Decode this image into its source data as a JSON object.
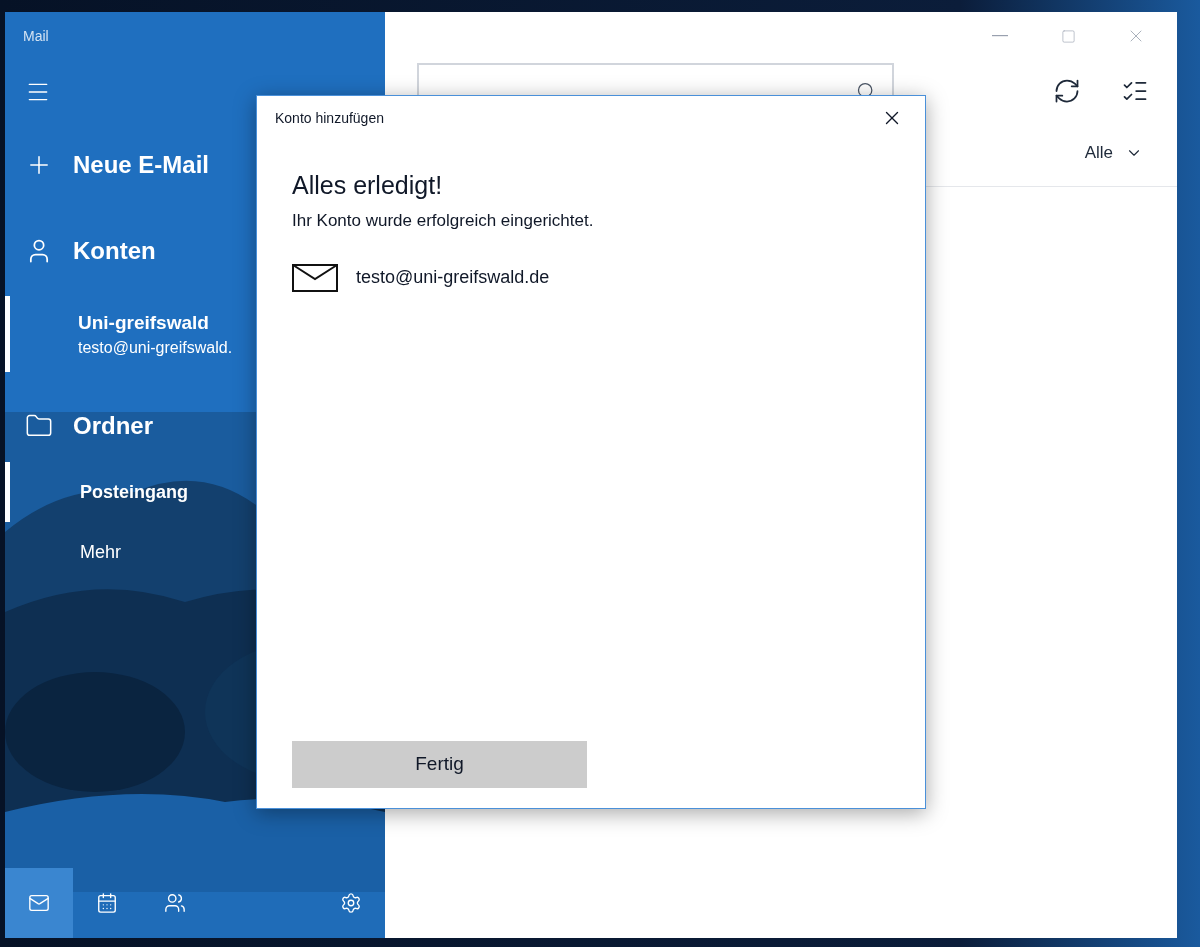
{
  "window": {
    "title": "Mail"
  },
  "sidebar": {
    "new_mail": "Neue E-Mail",
    "accounts_heading": "Konten",
    "accounts": [
      {
        "name": "Uni-greifswald",
        "email": "testo@uni-greifswald.",
        "selected": true
      }
    ],
    "folders_heading": "Ordner",
    "folders": [
      {
        "label": "Posteingang",
        "selected": true
      },
      {
        "label": "Mehr",
        "selected": false
      }
    ],
    "bottom_nav": [
      {
        "kind": "mail",
        "selected": true
      },
      {
        "kind": "calendar",
        "selected": false
      },
      {
        "kind": "people",
        "selected": false
      },
      {
        "kind": "settings",
        "selected": false
      }
    ]
  },
  "filter": {
    "value": "Alle"
  },
  "dialog": {
    "title": "Konto hinzufügen",
    "heading": "Alles erledigt!",
    "message": "Ihr Konto wurde erfolgreich eingerichtet.",
    "accounts": [
      {
        "email": "testo@uni-greifswald.de"
      }
    ],
    "button": "Fertig"
  }
}
